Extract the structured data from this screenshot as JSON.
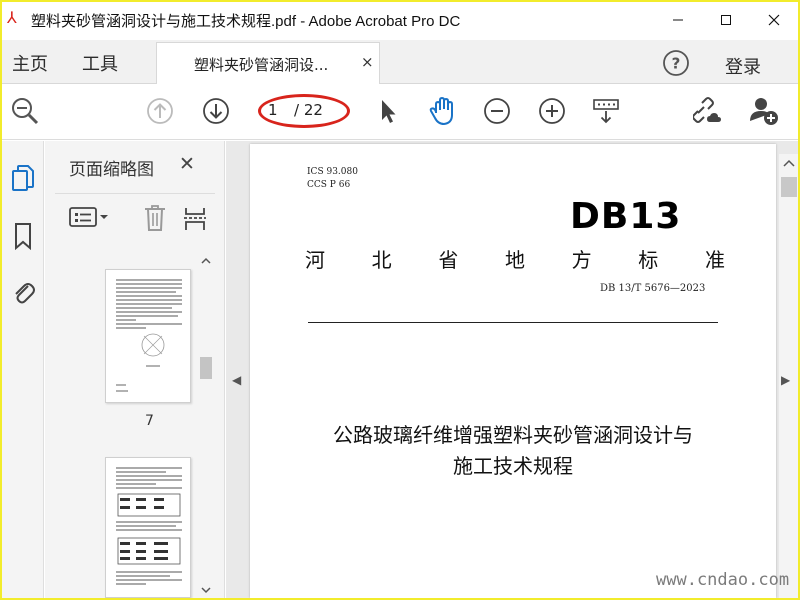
{
  "window": {
    "title": "塑料夹砂管涵洞设计与施工技术规程.pdf - Adobe Acrobat Pro DC"
  },
  "menu": {
    "home": "主页",
    "tools": "工具",
    "login": "登录"
  },
  "doc_tab": {
    "label": "塑料夹砂管涵洞设...",
    "close": "×"
  },
  "toolbar": {
    "current_page": "1",
    "total_pages": "/ 22"
  },
  "sidebar": {
    "panel_title": "页面缩略图",
    "close": "✕",
    "thumbnail_page_label": "7"
  },
  "document": {
    "ics_line1": "ICS  93.080",
    "ics_line2": "CCS  P  66",
    "logo": "DB13",
    "title_chars": [
      "河",
      "北",
      "省",
      "地",
      "方",
      "标",
      "准"
    ],
    "code": "DB 13/T  5676—2023",
    "heading_line1": "公路玻璃纤维增强塑料夹砂管涵洞设计与",
    "heading_line2": "施工技术规程"
  },
  "watermark": "www.cndao.com",
  "colors": {
    "frame_border": "#f2ec2c",
    "acrobat_red": "#d9241c",
    "hand_tool_blue": "#1a73c7"
  }
}
